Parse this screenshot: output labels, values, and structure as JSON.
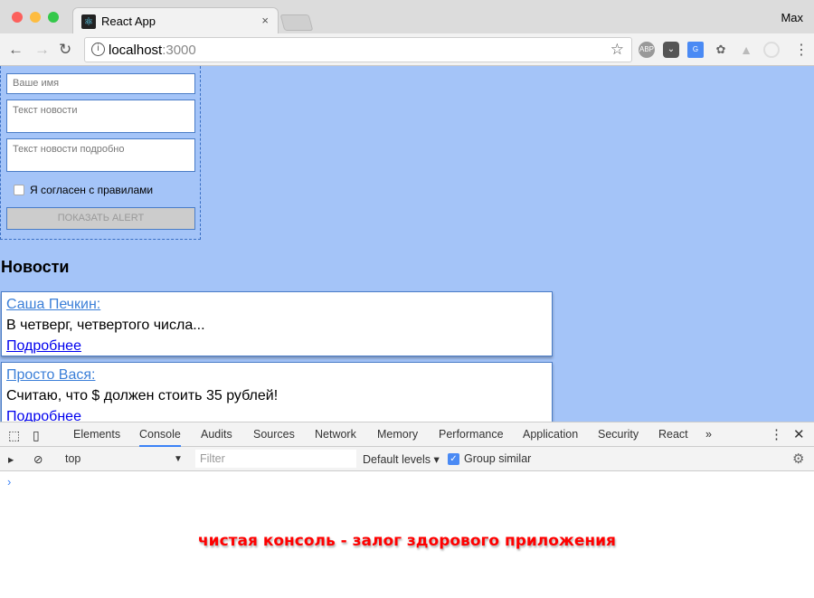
{
  "browser": {
    "tab_title": "React App",
    "tab_close": "×",
    "user": "Max",
    "url_host": "localhost",
    "url_port": ":3000",
    "icons": [
      "back-icon",
      "forward-icon",
      "reload-icon",
      "info-icon",
      "star-icon",
      "adblock-icon",
      "pocket-icon",
      "translate-icon",
      "extension-icon",
      "drive-icon",
      "extension-circle-icon",
      "menu-icon"
    ],
    "ext_abp": "ABP",
    "ext_g": "G"
  },
  "form": {
    "name_placeholder": "Ваше имя",
    "text_placeholder": "Текст новости",
    "bigtext_placeholder": "Текст новости подробно",
    "agree_label": "Я согласен с правилами",
    "agree_checked": false,
    "alert_button": "ПОКАЗАТЬ ALERT",
    "alert_disabled": true
  },
  "news": {
    "title": "Новости",
    "items": [
      {
        "author": "Саша Печкин:",
        "text": "В четверг, четвертого числа...",
        "more": "Подробнее"
      },
      {
        "author": "Просто Вася:",
        "text": "Считаю, что $ должен стоить 35 рублей!",
        "more": "Подробнее"
      }
    ]
  },
  "devtools": {
    "tabs": [
      "Elements",
      "Console",
      "Audits",
      "Sources",
      "Network",
      "Memory",
      "Performance",
      "Application",
      "Security",
      "React"
    ],
    "active_tab": "Console",
    "more": "»",
    "context": "top",
    "filter_placeholder": "Filter",
    "levels": "Default levels ▾",
    "group_similar": "Group similar",
    "group_similar_checked": true,
    "prompt": "›"
  },
  "caption": "чистая консоль - залог здорового приложения",
  "colors": {
    "page_bg": "#a4c4f8",
    "accent": "#4a7cc7",
    "caption": "#ff0000"
  }
}
